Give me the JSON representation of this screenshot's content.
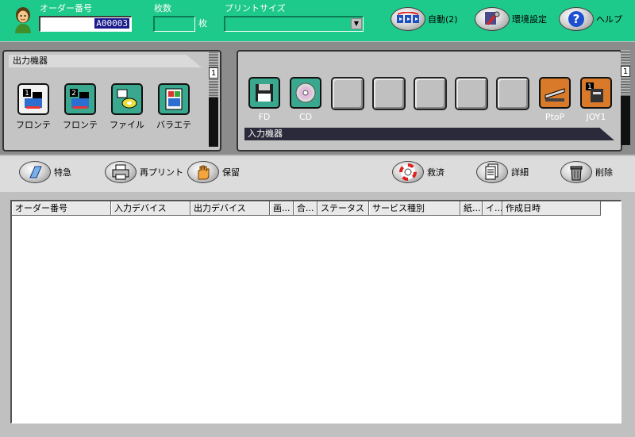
{
  "header": {
    "order_label": "オーダー番号",
    "order_value": "A00003",
    "count_label": "枚数",
    "count_unit": "枚",
    "print_size_label": "プリントサイズ",
    "auto_label": "自動(2)",
    "settings_label": "環境設定",
    "help_label": "ヘルプ"
  },
  "output_panel": {
    "title": "出力機器",
    "devices": [
      {
        "label": "フロンテ",
        "icon": "printer-1-icon"
      },
      {
        "label": "フロンテ",
        "icon": "printer-2-icon"
      },
      {
        "label": "ファイル",
        "icon": "file-disk-icon"
      },
      {
        "label": "バラエテ",
        "icon": "variety-icon"
      }
    ],
    "page": "1"
  },
  "input_panel": {
    "title": "入力機器",
    "devices": [
      {
        "label": "FD",
        "icon": "floppy-icon"
      },
      {
        "label": "CD",
        "icon": "cd-icon"
      },
      {
        "label": "PtoP",
        "icon": "scanner-icon"
      },
      {
        "label": "JOY1",
        "icon": "joy-device-icon"
      }
    ],
    "page": "1"
  },
  "toolbar": {
    "special_label": "特急",
    "reprint_label": "再プリント",
    "hold_label": "保留",
    "rescue_label": "救済",
    "detail_label": "詳細",
    "delete_label": "削除"
  },
  "table": {
    "columns": [
      "オーダー番号",
      "入力デバイス",
      "出力デバイス",
      "画...",
      "合...",
      "ステータス",
      "サービス種別",
      "紙...",
      "イ...",
      "作成日時"
    ]
  },
  "colors": {
    "header_green": "#1ec98c",
    "panel_gray": "#8c8c8c",
    "device_teal": "#3aa88e",
    "scanner_orange": "#d87a2a"
  }
}
